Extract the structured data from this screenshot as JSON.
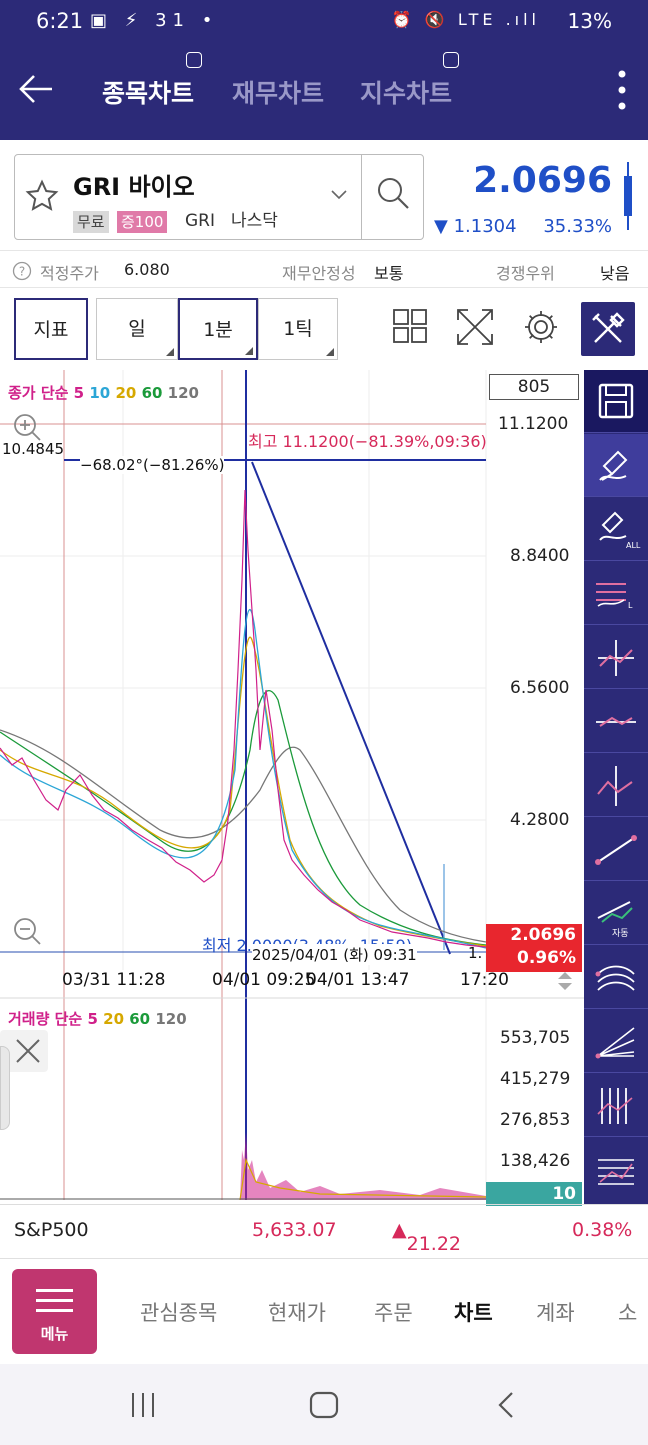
{
  "status_bar": {
    "time": "6:21",
    "battery": "13%",
    "left_icons": "▣ ⚡ 31 •",
    "right_icons": "⏰ 🔇 LTE .ıll"
  },
  "header": {
    "tabs": [
      {
        "label": "종목차트",
        "active": true
      },
      {
        "label": "재무차트",
        "active": false
      },
      {
        "label": "지수차트",
        "active": false
      }
    ]
  },
  "stock": {
    "name": "GRI 바이오",
    "tag_free": "무료",
    "tag_margin": "증100",
    "ticker": "GRI",
    "market": "나스닥",
    "price": "2.0696",
    "change": "1.1304",
    "change_pct": "35.33%"
  },
  "info": {
    "fair_price_label": "적정주가",
    "fair_price_value": "6.080",
    "fin_stability_label": "재무안정성",
    "fin_stability_value": "보통",
    "competition_label": "경쟁우위",
    "competition_value": "낮음"
  },
  "toolbar": {
    "indicator": "지표",
    "day": "일",
    "minute": "1분",
    "tick": "1틱"
  },
  "price_chart": {
    "legend_prefix": "종가 단순",
    "legend_periods": [
      "5",
      "10",
      "20",
      "60",
      "120"
    ],
    "legend_colors": [
      "#d0208a",
      "#2ca6d6",
      "#d6a800",
      "#1b9a3a",
      "#777777"
    ],
    "count_box": "805",
    "y_labels": [
      "11.1200",
      "8.8400",
      "6.5600",
      "4.2800"
    ],
    "crosshair_value": "10.4845",
    "high_label": "최고 11.1200(−81.39%,09:36)",
    "low_label": "최저 2.0000(3.48%, 15:59)",
    "angle_label": "−68.02°(−81.26%)",
    "crosshair_date": "2025/04/01 (화) 09:31",
    "last_price": "2.0696",
    "last_pct": "0.96%",
    "x_labels": [
      "03/31 11:28",
      "04/01 09:25",
      "04/01 13:47",
      "17:20"
    ],
    "partial_label": "1."
  },
  "volume_chart": {
    "legend_prefix": "거래량 단순",
    "legend_periods": [
      "5",
      "20",
      "60",
      "120"
    ],
    "legend_colors": [
      "#d0208a",
      "#d6a800",
      "#1b9a3a",
      "#777777"
    ],
    "y_labels": [
      "553,705",
      "415,279",
      "276,853",
      "138,426"
    ],
    "last_volume": "10"
  },
  "chart_data": {
    "type": "line",
    "title": "",
    "series": [
      {
        "name": "종가",
        "values": [
          3.4,
          3.0,
          2.6,
          2.9,
          2.3,
          2.2,
          2.4,
          2.1,
          1.9,
          2.3,
          3.5,
          5.6,
          9.8,
          8.0,
          6.4,
          5.2,
          4.4,
          3.6,
          3.0,
          2.7,
          2.5,
          2.3,
          2.2,
          2.1,
          2.0696
        ]
      }
    ],
    "y_ticks": [
      11.12,
      8.84,
      6.56,
      4.28
    ],
    "high": 11.12,
    "low": 2.0,
    "x_labels": [
      "03/31 11:28",
      "04/01 09:25",
      "04/01 13:47",
      "17:20"
    ]
  },
  "market_row": {
    "index_name": "S&P500",
    "value": "5,633.07",
    "change": "21.22",
    "pct": "0.38%"
  },
  "bottom_nav": {
    "menu": "메뉴",
    "items": [
      "관심종목",
      "현재가",
      "주문",
      "차트",
      "계좌",
      "소"
    ]
  },
  "colors": {
    "header": "#2c2a78",
    "up": "#d6295a",
    "down": "#1f4fc7",
    "menu": "#c0366f"
  }
}
